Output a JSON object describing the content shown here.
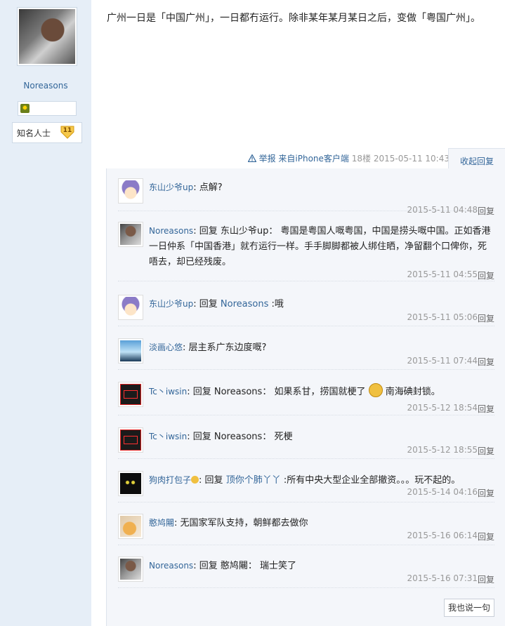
{
  "author": {
    "username": "Noreasons",
    "rank_label": "知名人士",
    "rank_level": "11"
  },
  "post": {
    "text": "广州一日是「中国广州」，一日都冇运行。除非某年某月某日之后，变做「粤国广州」。"
  },
  "meta": {
    "report": "举报",
    "client": "来自iPhone客户端",
    "floor": "18楼",
    "datetime": "2015-05-11 10:43",
    "collapse": "收起回复"
  },
  "replies": [
    {
      "nick": "东山少爷up",
      "text": "点解?",
      "time": "2015-5-11 04:48",
      "reply": "回复"
    },
    {
      "nick": "Noreasons",
      "prefix": "回复 东山少爷up：",
      "text": "粤国是粤国人嘅粤国，中国是捞头嘅中国。正如香港一日仲系「中国香港」就冇运行一样。手手脚脚都被人绑住晒，净留翻个口俾你，死唔去，却已经残废。",
      "time": "2015-5-11 04:55",
      "reply": "回复"
    },
    {
      "nick": "东山少爷up",
      "prefix": "回复",
      "mention": "Noreasons",
      "text": ":哦",
      "time": "2015-5-11 05:06",
      "reply": "回复"
    },
    {
      "nick": "淡画心悠",
      "text": "层主系广东边度嘅?",
      "time": "2015-5-11 07:44",
      "reply": "回复"
    },
    {
      "nick": "Tc丶iwsin",
      "prefix": "回复 Noreasons：",
      "text_a": "如果系甘，捞国就梗了",
      "text_b": "南海碘封锁。",
      "time": "2015-5-12 18:54",
      "reply": "回复"
    },
    {
      "nick": "Tc丶iwsin",
      "prefix": "回复 Noreasons：",
      "text": "死梗",
      "time": "2015-5-12 18:55",
      "reply": "回复"
    },
    {
      "nick": "狗肉打包子",
      "prefix": "回复",
      "mention": "顶你个肺丫丫",
      "text": ":所有中央大型企业全部撤资。。。玩不起的。",
      "time": "2015-5-14 04:16",
      "reply": "回复"
    },
    {
      "nick": "憨鸠闀",
      "text": "无国家军队支持，朝鲜都去做你",
      "time": "2015-5-16 06:14",
      "reply": "回复"
    },
    {
      "nick": "Noreasons",
      "prefix": "回复 憨鸠闀：",
      "text": "瑞士笑了",
      "time": "2015-5-16 07:31",
      "reply": "回复"
    }
  ],
  "say_button": "我也说一句",
  "icons": {
    "report": "warning-icon",
    "medal": "medal-icon",
    "rank": "rank-badge-icon"
  }
}
